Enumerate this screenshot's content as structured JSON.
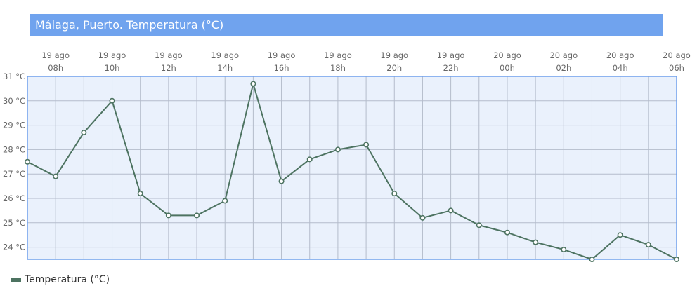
{
  "chart_data": {
    "type": "line",
    "title": "Málaga, Puerto. Temperatura (°C)",
    "x_ticks": [
      [
        "19 ago",
        "08h"
      ],
      [
        "19 ago",
        "10h"
      ],
      [
        "19 ago",
        "12h"
      ],
      [
        "19 ago",
        "14h"
      ],
      [
        "19 ago",
        "16h"
      ],
      [
        "19 ago",
        "18h"
      ],
      [
        "19 ago",
        "20h"
      ],
      [
        "19 ago",
        "22h"
      ],
      [
        "20 ago",
        "00h"
      ],
      [
        "20 ago",
        "02h"
      ],
      [
        "20 ago",
        "04h"
      ],
      [
        "20 ago",
        "06h"
      ]
    ],
    "y_ticks": [
      "31 °C",
      "30 °C",
      "29 °C",
      "28 °C",
      "27 °C",
      "26 °C",
      "25 °C",
      "24 °C"
    ],
    "ylim": [
      23.5,
      31
    ],
    "series": [
      {
        "name": "Temperatura (°C)",
        "color": "#4d7361",
        "x": [
          "07:00",
          "08:00",
          "09:00",
          "10:00",
          "11:00",
          "12:00",
          "13:00",
          "14:00",
          "15:00",
          "16:00",
          "17:00",
          "18:00",
          "19:00",
          "20:00",
          "21:00",
          "22:00",
          "23:00",
          "00:00",
          "01:00",
          "02:00",
          "03:00",
          "04:00",
          "05:00",
          "06:00"
        ],
        "values": [
          27.5,
          26.9,
          28.7,
          30.0,
          26.2,
          25.3,
          25.3,
          25.9,
          30.7,
          26.7,
          27.6,
          28.0,
          28.2,
          26.2,
          25.2,
          25.5,
          24.9,
          24.6,
          24.2,
          23.9,
          23.5,
          24.5,
          24.1,
          23.5
        ]
      }
    ],
    "grid": true,
    "legend": "bottom-left",
    "colors": {
      "title_bg": "#70a3ee",
      "plot_bg": "#eaf1fc",
      "grid": "#b4bccb",
      "border": "#6fa0ec"
    }
  }
}
